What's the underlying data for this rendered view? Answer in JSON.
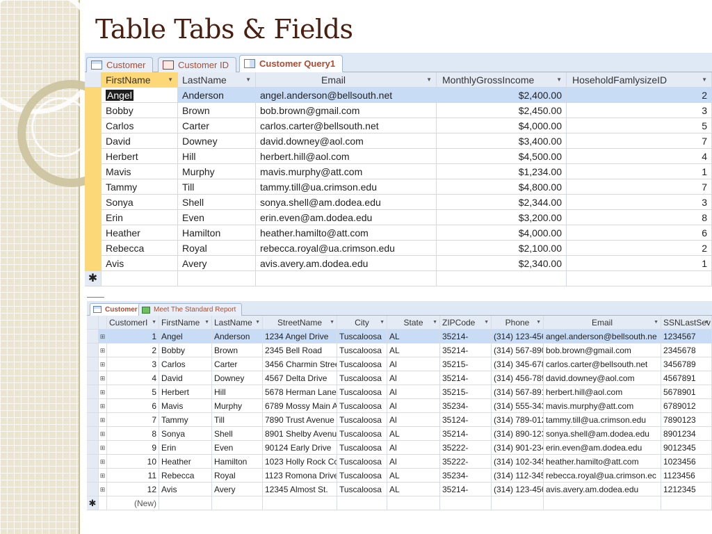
{
  "slide_title": "Table Tabs & Fields",
  "window1": {
    "tabs": [
      {
        "label": "Customer",
        "icon": "table-icon",
        "active": false
      },
      {
        "label": "Customer ID",
        "icon": "form-icon",
        "active": false
      },
      {
        "label": "Customer Query1",
        "icon": "query-icon",
        "active": true
      }
    ],
    "columns": [
      "FirstName",
      "LastName",
      "Email",
      "MonthlyGrossIncome",
      "HoseholdFamlysizeID"
    ],
    "rows": [
      [
        "Angel",
        "Anderson",
        "angel.anderson@bellsouth.net",
        "$2,400.00",
        "2"
      ],
      [
        "Bobby",
        "Brown",
        "bob.brown@gmail.com",
        "$2,450.00",
        "3"
      ],
      [
        "Carlos",
        "Carter",
        "carlos.carter@bellsouth.net",
        "$4,000.00",
        "5"
      ],
      [
        "David",
        "Downey",
        "david.downey@aol.com",
        "$3,400.00",
        "7"
      ],
      [
        "Herbert",
        "Hill",
        "herbert.hill@aol.com",
        "$4,500.00",
        "4"
      ],
      [
        "Mavis",
        "Murphy",
        "mavis.murphy@att.com",
        "$1,234.00",
        "1"
      ],
      [
        "Tammy",
        "Till",
        "tammy.till@ua.crimson.edu",
        "$4,800.00",
        "7"
      ],
      [
        "Sonya",
        "Shell",
        "sonya.shell@am.dodea.edu",
        "$2,344.00",
        "3"
      ],
      [
        "Erin",
        "Even",
        "erin.even@am.dodea.edu",
        "$3,200.00",
        "8"
      ],
      [
        "Heather",
        "Hamilton",
        "heather.hamilto@att.com",
        "$4,000.00",
        "6"
      ],
      [
        "Rebecca",
        "Royal",
        "rebecca.royal@ua.crimson.edu",
        "$2,100.00",
        "2"
      ],
      [
        "Avis",
        "Avery",
        "avis.avery.am.dodea.edu",
        "$2,340.00",
        "1"
      ]
    ],
    "new_row_marker": "✱"
  },
  "window2": {
    "tabs": [
      {
        "label": "Customer",
        "icon": "table-icon",
        "active": true
      },
      {
        "label": "Meet The Standard Report",
        "icon": "report-icon",
        "active": false
      }
    ],
    "columns": [
      "CustomerI",
      "FirstName",
      "LastName",
      "StreetName",
      "City",
      "State",
      "ZIPCode",
      "Phone",
      "Email",
      "SSNLastSev"
    ],
    "rows": [
      [
        "1",
        "Angel",
        "Anderson",
        "1234 Angel Drive",
        "Tuscaloosa",
        "AL",
        "35214-",
        "(314) 123-456",
        "angel.anderson@bellsouth.ne",
        "1234567"
      ],
      [
        "2",
        "Bobby",
        "Brown",
        "2345 Bell Road",
        "Tuscaloosa",
        "AL",
        "35214-",
        "(314) 567-890",
        "bob.brown@gmail.com",
        "2345678"
      ],
      [
        "3",
        "Carlos",
        "Carter",
        "3456 Charmin Stree",
        "Tuscaloosa",
        "Al",
        "35215-",
        "(314) 345-678",
        "carlos.carter@bellsouth.net",
        "3456789"
      ],
      [
        "4",
        "David",
        "Downey",
        "4567 Delta Drive",
        "Tuscaloosa",
        "Al",
        "35214-",
        "(314) 456-789",
        "david.downey@aol.com",
        "4567891"
      ],
      [
        "5",
        "Herbert",
        "Hill",
        "5678 Herman Lane",
        "Tuscaloosa",
        "Al",
        "35215-",
        "(314) 567-891",
        "herbert.hill@aol.com",
        "5678901"
      ],
      [
        "6",
        "Mavis",
        "Murphy",
        "6789 Mossy Main A",
        "Tuscaloosa",
        "Al",
        "35234-",
        "(314) 555-343",
        "mavis.murphy@att.com",
        "6789012"
      ],
      [
        "7",
        "Tammy",
        "Till",
        "7890 Trust Avenue",
        "Tuscaloosa",
        "Al",
        "35124-",
        "(314) 789-012",
        "tammy.till@ua.crimson.edu",
        "7890123"
      ],
      [
        "8",
        "Sonya",
        "Shell",
        "8901 Shelby Avenu",
        "Tuscaloosa",
        "AL",
        "35214-",
        "(314) 890-123",
        "sonya.shell@am.dodea.edu",
        "8901234"
      ],
      [
        "9",
        "Erin",
        "Even",
        "90124 Early Drive",
        "Tuscaloosa",
        "Al",
        "35222-",
        "(314) 901-234",
        "erin.even@am.dodea.edu",
        "9012345"
      ],
      [
        "10",
        "Heather",
        "Hamilton",
        "1023 Holly Rock Cc",
        "Tuscaloosa",
        "Al",
        "35222-",
        "(314) 102-345",
        "heather.hamilto@att.com",
        "1023456"
      ],
      [
        "11",
        "Rebecca",
        "Royal",
        "1123 Romona Drive",
        "Tuscaloosa",
        "AL",
        "35234-",
        "(314) 112-345",
        "rebecca.royal@ua.crimson.ec",
        "1123456"
      ],
      [
        "12",
        "Avis",
        "Avery",
        "12345 Almost St.",
        "Tuscaloosa",
        "AL",
        "35214-",
        "(314) 123-456",
        "avis.avery.am.dodea.edu",
        "1212345"
      ]
    ],
    "new_row_marker": "✱",
    "new_label": "(New)",
    "expand_symbol": "⊞"
  }
}
